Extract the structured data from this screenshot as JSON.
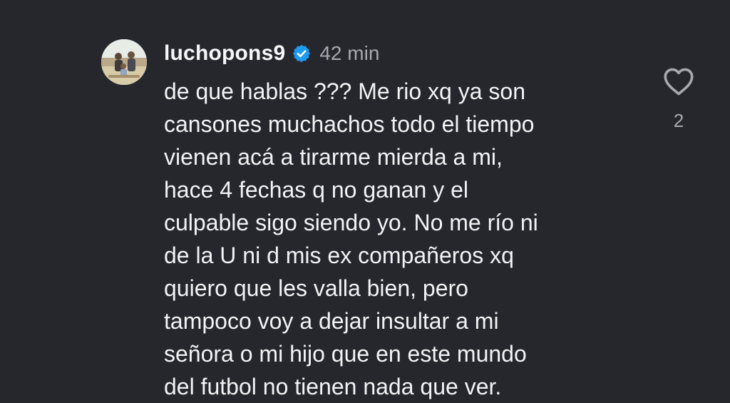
{
  "comment": {
    "username": "luchopons9",
    "verified": true,
    "time": "42 min",
    "lines": [
      "de que hablas ??? Me rio xq ya son",
      "cansones muchachos todo el tiempo",
      "vienen acá a tirarme mierda a mi,",
      "hace 4 fechas q no ganan y el",
      "culpable sigo siendo yo. No me río ni",
      "de la U ni d mis ex compañeros xq",
      "quiero que les valla bien, pero",
      "tampoco voy a dejar insultar a mi",
      "señora o mi hijo que en este mundo",
      "del futbol no tienen nada que ver."
    ],
    "like_count": "2",
    "icons": {
      "verified": "verified-badge-icon",
      "like": "heart-outline-icon"
    }
  },
  "colors": {
    "background": "#25272d",
    "text": "#f3f3f5",
    "muted": "#a8a9ad",
    "verified": "#1d9bf0"
  }
}
